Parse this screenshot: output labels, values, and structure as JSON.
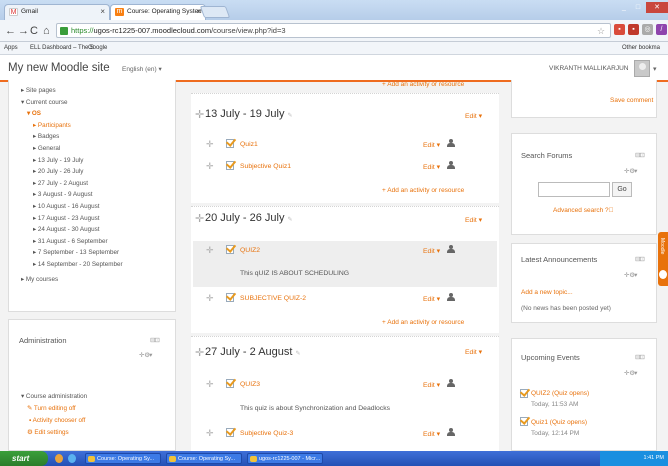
{
  "browser": {
    "tabs": [
      {
        "label": "Gmail",
        "icon": "gmail-icon"
      },
      {
        "label": "Course: Operating System",
        "icon": "moodle-icon"
      }
    ],
    "url_scheme": "https://",
    "url_host": "ugos-rc1225-007.moodlecloud.com",
    "url_path": "/course/view.php?id=3",
    "bookmarks": [
      "Apps",
      "ELL Dashboard – The S",
      "Google"
    ],
    "other_bookmarks": "Other bookma"
  },
  "header": {
    "site_name": "My new Moodle site",
    "language": "English (en) ▾",
    "user_name": "VIKRANTH MALLIKARJUN"
  },
  "nav": {
    "items": [
      {
        "label": "▸ Site pages",
        "class": ""
      },
      {
        "label": "▾ Current course",
        "class": ""
      },
      {
        "label": "▾ OS",
        "class": "orange"
      },
      {
        "label": "▸ Participants",
        "class": "orange"
      },
      {
        "label": "▸ Badges",
        "class": ""
      },
      {
        "label": "▸ General",
        "class": ""
      },
      {
        "label": "▸ 13 July - 19 July",
        "class": ""
      },
      {
        "label": "▸ 20 July - 26 July",
        "class": ""
      },
      {
        "label": "▸ 27 July - 2 August",
        "class": ""
      },
      {
        "label": "▸ 3 August - 9 August",
        "class": ""
      },
      {
        "label": "▸ 10 August - 16 August",
        "class": ""
      },
      {
        "label": "▸ 17 August - 23 August",
        "class": ""
      },
      {
        "label": "▸ 24 August - 30 August",
        "class": ""
      },
      {
        "label": "▸ 31 August - 6 September",
        "class": ""
      },
      {
        "label": "▸ 7 September - 13 September",
        "class": ""
      },
      {
        "label": "▸ 14 September - 20 September",
        "class": ""
      }
    ],
    "my_courses": "▸ My courses"
  },
  "admin": {
    "title": "Administration",
    "course_admin": "▾ Course administration",
    "turn_editing_off": "Turn editing off",
    "activity_chooser_off": "Activity chooser off",
    "edit_settings": "Edit settings"
  },
  "main": {
    "top_add_activity": "+ Add an activity or resource",
    "sections": [
      {
        "title": "13 July - 19 July",
        "edit": "Edit ▾",
        "activities": [
          {
            "name": "Quiz1",
            "edit": "Edit ▾"
          },
          {
            "name": "Subjective Quiz1",
            "edit": "Edit ▾"
          }
        ],
        "add": "+ Add an activity or resource"
      },
      {
        "title": "20 July - 26 July",
        "edit": "Edit ▾",
        "activities": [
          {
            "name": "QUIZ2",
            "edit": "Edit ▾",
            "description": "This  qUIZ IS ABOUT SCHEDULING"
          },
          {
            "name": "SUBJECTIVE QUIZ-2",
            "edit": "Edit ▾"
          }
        ],
        "add": "+ Add an activity or resource"
      },
      {
        "title": "27 July - 2 August",
        "edit": "Edit ▾",
        "activities": [
          {
            "name": "QUIZ3",
            "edit": "Edit ▾",
            "description": "This quiz is about Synchronization and Deadlocks"
          },
          {
            "name": "Subjective Quiz-3",
            "edit": "Edit ▾"
          }
        ]
      }
    ]
  },
  "right": {
    "save_comment": "Save comment",
    "search_forums": {
      "title": "Search Forums",
      "go": "Go",
      "advanced": "Advanced search"
    },
    "announcements": {
      "title": "Latest Announcements",
      "add": "Add a new topic...",
      "none": "(No news has been posted yet)"
    },
    "events": {
      "title": "Upcoming Events",
      "items": [
        {
          "name": "QUIZ2 (Quiz opens)",
          "time": "Today, 11:53 AM"
        },
        {
          "name": "Quiz1 (Quiz opens)",
          "time": "Today, 12:14 PM"
        }
      ]
    },
    "sidetab": "Moodle"
  },
  "taskbar": {
    "start": "start",
    "buttons": [
      "Course: Operating Sy...",
      "Course: Operating Sy...",
      "ugos-rc1225-007 - Micr..."
    ],
    "clock": "1:41 PM"
  },
  "colors": {
    "accent": "#e8720c",
    "taskbar": "#2350b5"
  }
}
